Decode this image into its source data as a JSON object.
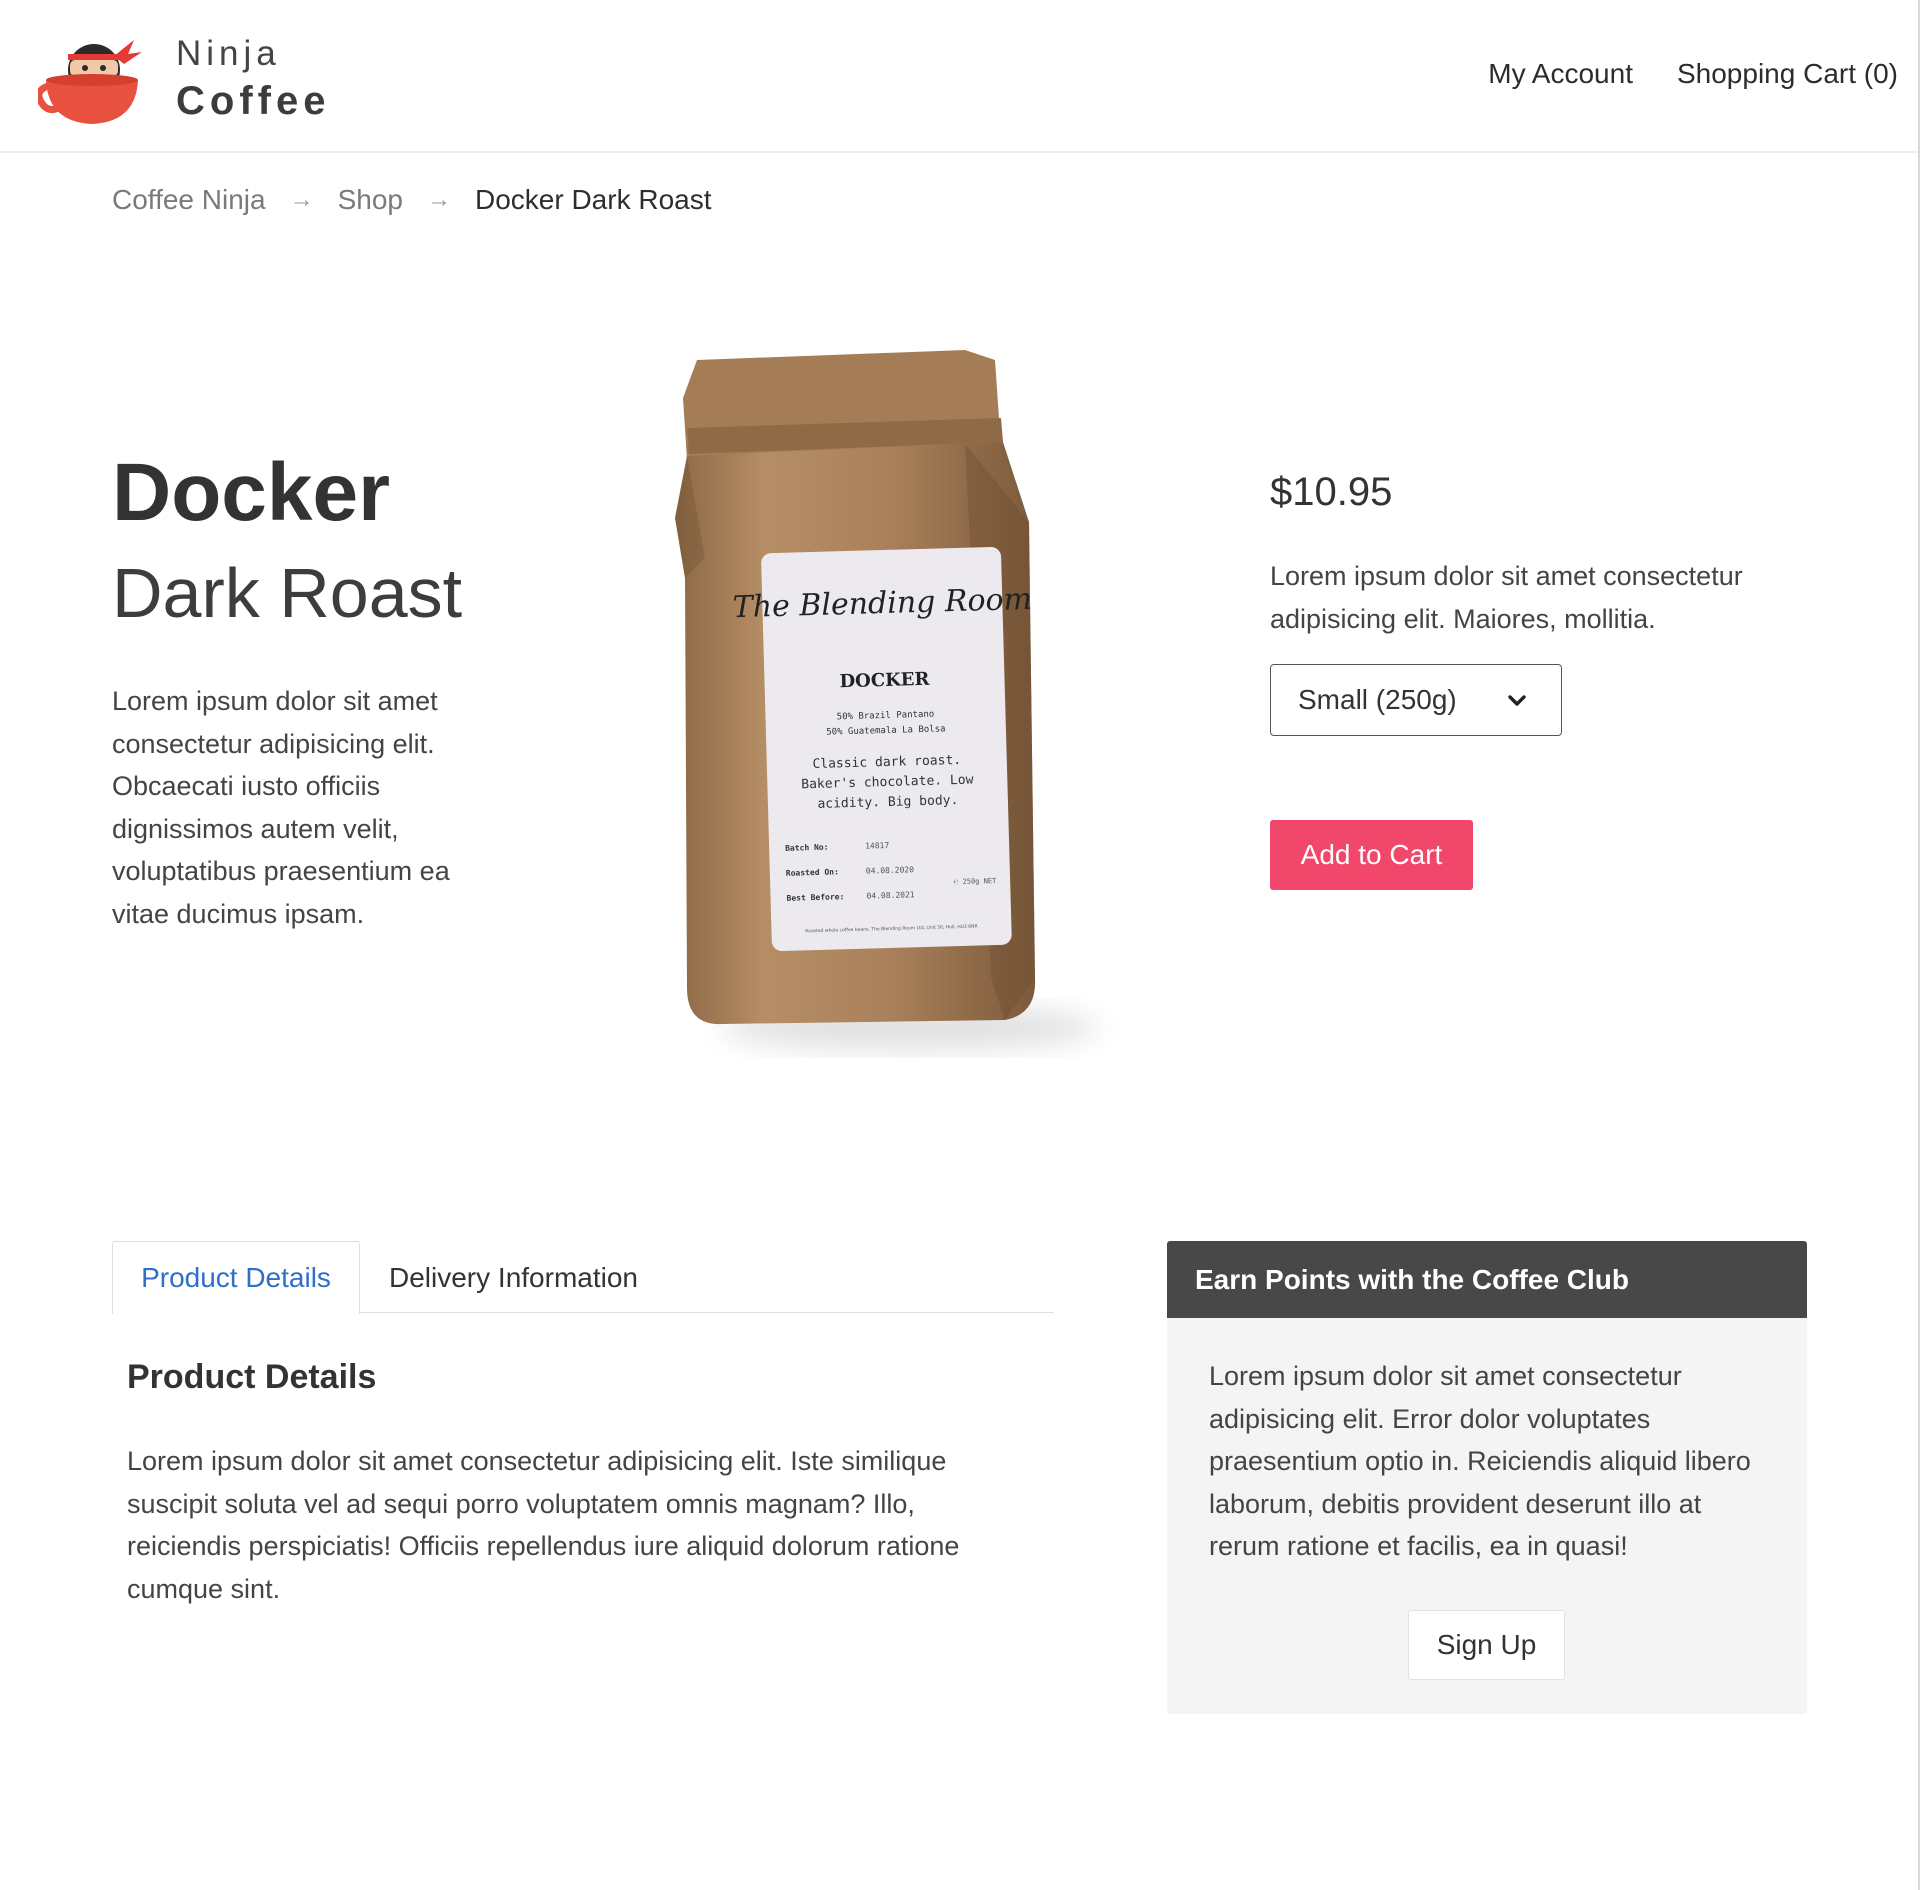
{
  "brand": {
    "line1": "Ninja",
    "line2": "Coffee",
    "logo_icon": "ninja-coffee-cup-logo"
  },
  "nav": {
    "account": "My Account",
    "cart": "Shopping Cart (0)"
  },
  "breadcrumb": {
    "items": [
      "Coffee Ninja",
      "Shop",
      "Docker Dark Roast"
    ],
    "separator": "→"
  },
  "product": {
    "name": "Docker",
    "subtitle": "Dark Roast",
    "description": "Lorem ipsum dolor sit amet consectetur adipisicing elit. Obcaecati iusto officiis dignissimos autem velit, voluptatibus praesentium ea vitae ducimus ipsam.",
    "image_label": {
      "signature": "The Blending Room",
      "name": "DOCKER",
      "blend_1": "50% Brazil Pantano",
      "blend_2": "50% Guatemala La Bolsa",
      "notes_1": "Classic dark roast.",
      "notes_2": "Baker's chocolate. Low",
      "notes_3": "acidity. Big body.",
      "batch_label": "Batch No:",
      "batch_value": "14817",
      "roasted_label": "Roasted On:",
      "roasted_value": "04.08.2020",
      "best_label": "Best Before:",
      "best_value": "04.08.2021",
      "weight": "℮ 250g NET",
      "footer": "Roasted whole coffee beans. The Blending Room Ltd, Unit 30, Hull, HU3 6NR"
    }
  },
  "purchase": {
    "price": "$10.95",
    "description": "Lorem ipsum dolor sit amet consectetur adipisicing elit. Maiores, mollitia.",
    "size_selected": "Small (250g)",
    "add_to_cart": "Add to Cart"
  },
  "tabs": {
    "items": [
      "Product Details",
      "Delivery Information"
    ],
    "active": "Product Details",
    "heading": "Product Details",
    "content": "Lorem ipsum dolor sit amet consectetur adipisicing elit. Iste similique suscipit soluta vel ad sequi porro voluptatem omnis magnam? Illo, reiciendis perspiciatis! Officiis repellendus iure aliquid dolorum ratione cumque sint."
  },
  "club": {
    "title": "Earn Points with the Coffee Club",
    "text": "Lorem ipsum dolor sit amet consectetur adipisicing elit. Error dolor voluptates praesentium optio in. Reiciendis aliquid libero laborum, debitis provident deserunt illo at rerum ratione et facilis, ea in quasi!",
    "signup": "Sign Up"
  },
  "colors": {
    "accent": "#f0476b",
    "link": "#2f6fc9",
    "club_header": "#484848",
    "club_bg": "#f4f4f4",
    "logo_cup": "#e8513f"
  }
}
